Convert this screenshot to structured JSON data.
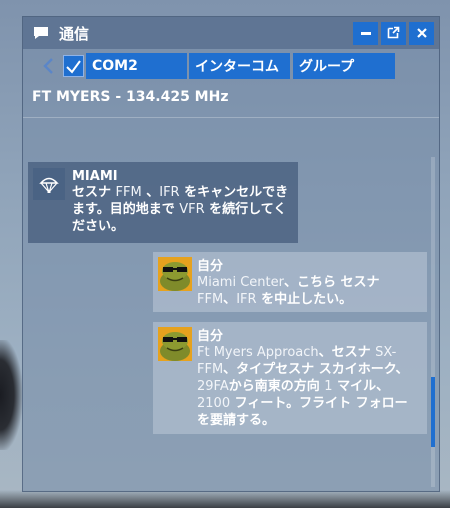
{
  "window": {
    "title": "通信",
    "icons": [
      "chat-icon",
      "minimize-icon",
      "popout-icon",
      "close-icon"
    ]
  },
  "tabs": {
    "back_icon": "chevron-left-icon",
    "check_icon": "checkmark-icon",
    "items": [
      {
        "label": "COM2"
      },
      {
        "label": "インターコム"
      },
      {
        "label": "グループ"
      }
    ]
  },
  "frequency": "FT MYERS - 134.425 MHz",
  "messages": [
    {
      "sender": "MIAMI",
      "avatar": "atc-parachute-icon",
      "segments": [
        {
          "t": "セスナ ",
          "light": false
        },
        {
          "t": "FFM",
          "light": true
        },
        {
          "t": " 、",
          "light": false
        },
        {
          "t": "IFR",
          "light": true
        },
        {
          "t": " をキャンセルできます。目的地まで ",
          "light": false
        },
        {
          "t": "VFR",
          "light": true
        },
        {
          "t": " を続行してください。",
          "light": false
        }
      ]
    },
    {
      "sender": "自分",
      "avatar": "pilot-frog-avatar",
      "segments": [
        {
          "t": "Miami Center",
          "light": true
        },
        {
          "t": "、こちら セスナ ",
          "light": false
        },
        {
          "t": "FFM",
          "light": true
        },
        {
          "t": "、",
          "light": false
        },
        {
          "t": "IFR",
          "light": true
        },
        {
          "t": " を中止したい。",
          "light": false
        }
      ]
    },
    {
      "sender": "自分",
      "avatar": "pilot-frog-avatar",
      "segments": [
        {
          "t": "Ft Myers Approach",
          "light": true
        },
        {
          "t": "、セスナ ",
          "light": false
        },
        {
          "t": "SX-FFM",
          "light": true
        },
        {
          "t": "、タイプセスナ スカイホーク、",
          "light": false
        },
        {
          "t": "29FA",
          "light": true
        },
        {
          "t": "から南東の方向 ",
          "light": false
        },
        {
          "t": "1",
          "light": true
        },
        {
          "t": " マイル、",
          "light": false
        },
        {
          "t": "2100",
          "light": true
        },
        {
          "t": " フィート。フライト フォローを要請する。",
          "light": false
        }
      ]
    }
  ],
  "colors": {
    "accent": "#1f6fd0"
  }
}
